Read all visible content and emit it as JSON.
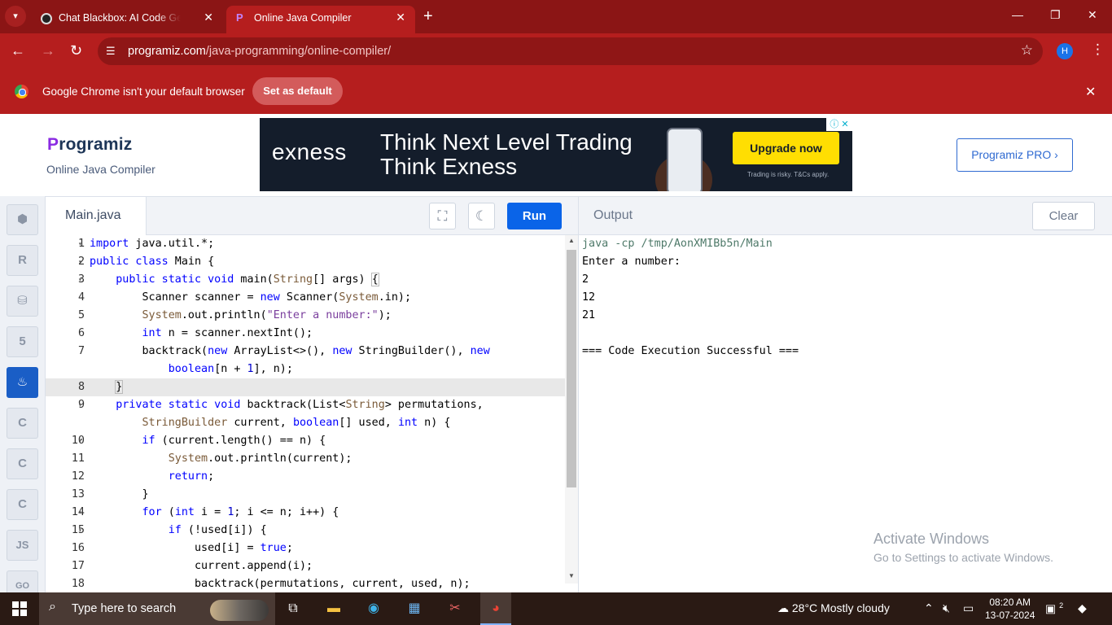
{
  "browser": {
    "tabs": [
      {
        "title": "Chat Blackbox: AI Code Generat",
        "active": false
      },
      {
        "title": "Online Java Compiler",
        "active": true
      }
    ],
    "url_domain": "programiz.com",
    "url_path": "/java-programming/online-compiler/",
    "profile_initial": "H",
    "accent_color": "#b51e1e"
  },
  "infobar": {
    "message": "Google Chrome isn't your default browser",
    "button": "Set as default"
  },
  "site": {
    "logo": "rogramiz",
    "logo_p": "P",
    "subtitle": "Online Java Compiler",
    "pro_button": "Programiz PRO ›"
  },
  "ad": {
    "brand": "exness",
    "headline1": "Think Next Level Trading",
    "headline2": "Think Exness",
    "cta": "Upgrade now",
    "disclaimer": "Trading is risky. T&Cs apply."
  },
  "languages": [
    {
      "icon": "python-icon",
      "label": "",
      "active": false
    },
    {
      "icon": "r-icon",
      "label": "R",
      "active": false
    },
    {
      "icon": "database-icon",
      "label": "",
      "active": false
    },
    {
      "icon": "html5-icon",
      "label": "5",
      "active": false
    },
    {
      "icon": "java-icon",
      "label": "♨",
      "active": true
    },
    {
      "icon": "c-icon",
      "label": "C",
      "active": false
    },
    {
      "icon": "cpp-icon",
      "label": "C",
      "active": false
    },
    {
      "icon": "csharp-icon",
      "label": "C",
      "active": false
    },
    {
      "icon": "js-icon",
      "label": "JS",
      "active": false
    },
    {
      "icon": "go-icon",
      "label": "GO",
      "active": false
    }
  ],
  "editor": {
    "filename": "Main.java",
    "run_label": "Run",
    "current_line": 8
  },
  "output": {
    "title": "Output",
    "clear_label": "Clear",
    "lines": [
      "java -cp /tmp/AonXMIBb5n/Main",
      "Enter a number:",
      "2",
      "12",
      "21",
      "",
      "=== Code Execution Successful ==="
    ]
  },
  "watermark": {
    "title": "Activate Windows",
    "subtitle": "Go to Settings to activate Windows."
  },
  "taskbar": {
    "search_placeholder": "Type here to search",
    "weather": "28°C  Mostly cloudy",
    "time": "08:20 AM",
    "date": "13-07-2024",
    "notification_count": "2"
  }
}
